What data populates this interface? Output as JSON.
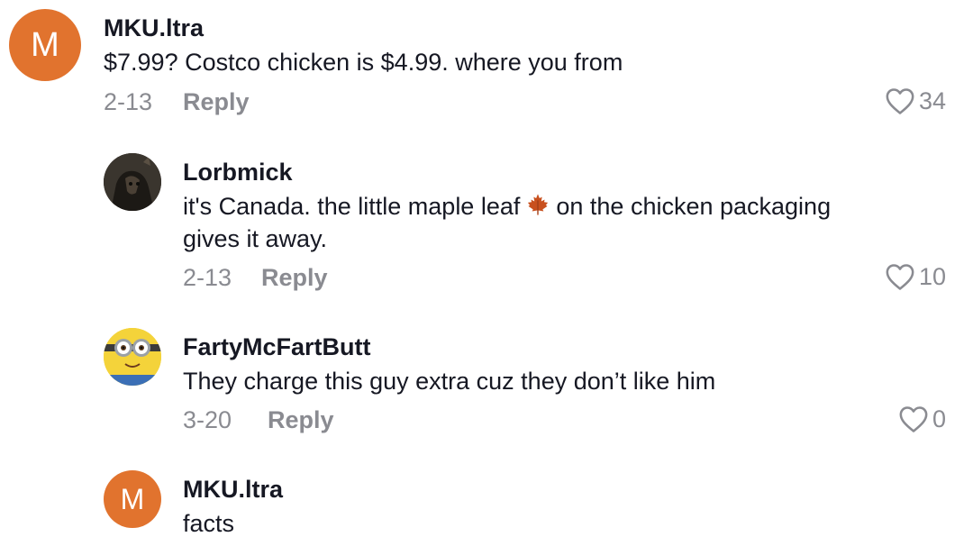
{
  "comments": [
    {
      "avatar_letter": "M",
      "username": "MKU.ltra",
      "text": "$7.99? Costco chicken is $4.99. where you from",
      "date": "2-13",
      "reply_label": "Reply",
      "likes": "34"
    },
    {
      "username": "Lorbmick",
      "text_before": "it's Canada. the little maple leaf",
      "text_after": "on the chicken packaging",
      "text_line2": "gives it away.",
      "date": "2-13",
      "reply_label": "Reply",
      "likes": "10"
    },
    {
      "username": "FartyMcFartButt",
      "text": "They charge this guy extra cuz they don’t like him",
      "date": "3-20",
      "reply_label": "Reply",
      "likes": "0"
    },
    {
      "avatar_letter": "M",
      "username": "MKU.ltra",
      "text": "facts"
    }
  ],
  "colors": {
    "avatar_orange": "#e1732e",
    "meta_gray": "#8a8b91",
    "text": "#161823"
  },
  "icons": {
    "like": "heart-outline-icon",
    "maple_leaf": "maple-leaf-emoji"
  }
}
